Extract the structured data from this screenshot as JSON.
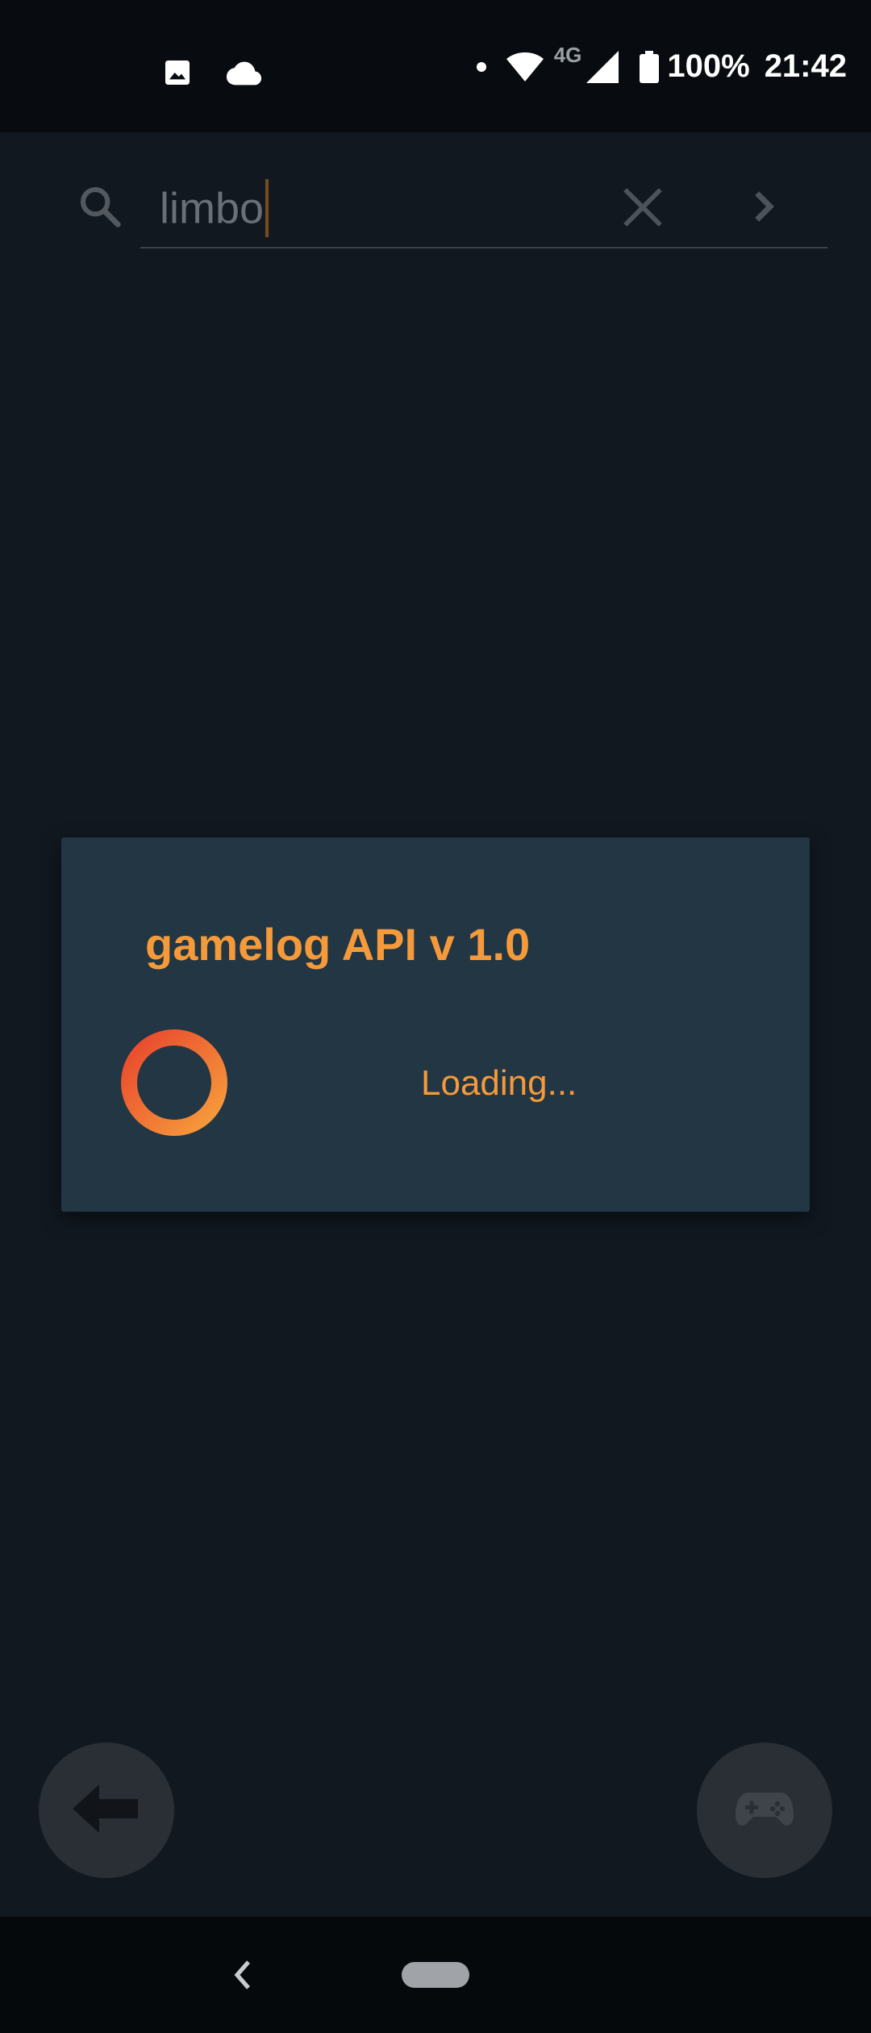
{
  "status_bar": {
    "left_icons": [
      "image-icon",
      "cloud-icon"
    ],
    "network_label": "4G",
    "battery_percent": "100%",
    "time": "21:42"
  },
  "search": {
    "query": "limbo",
    "icons": {
      "search": "search-icon",
      "clear": "close-icon",
      "go": "chevron-right-icon"
    }
  },
  "dialog": {
    "title": "gamelog API v 1.0",
    "message": "Loading..."
  },
  "fabs": {
    "back_icon": "arrow-left-icon",
    "game_icon": "gamepad-icon"
  },
  "colors": {
    "accent": "#f59a3b",
    "spinner_start": "#e8452d",
    "spinner_end": "#f7a03c",
    "dialog_bg": "#223643",
    "background": "#111820"
  }
}
